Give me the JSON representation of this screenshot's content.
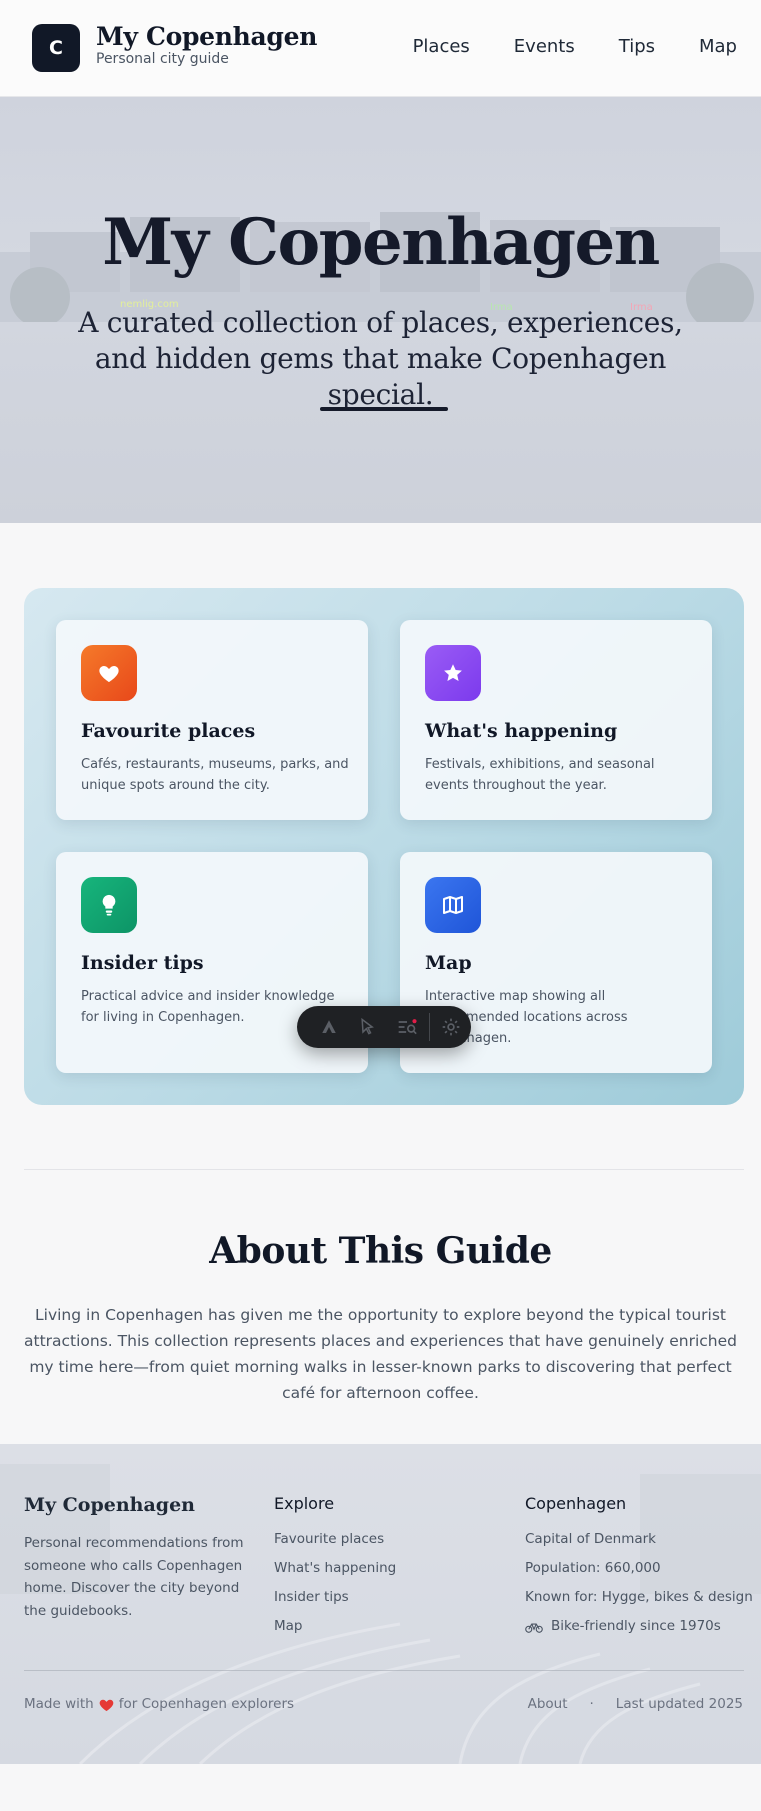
{
  "header": {
    "logo_letter": "C",
    "title": "My Copenhagen",
    "subtitle": "Personal city guide",
    "nav": [
      "Places",
      "Events",
      "Tips",
      "Map"
    ]
  },
  "hero": {
    "title": "My Copenhagen",
    "subtitle": "A curated collection of places, experiences, and hidden gems that make Copenhagen special."
  },
  "features": [
    {
      "title": "Favourite places",
      "description": "Cafés, restaurants, museums, parks, and unique spots around the city.",
      "icon": "heart-icon",
      "color": "#f05a1e"
    },
    {
      "title": "What's happening",
      "description": "Festivals, exhibitions, and seasonal events throughout the year.",
      "icon": "star-icon",
      "color": "#8b4cf0"
    },
    {
      "title": "Insider tips",
      "description": "Practical advice and insider knowledge for living in Copenhagen.",
      "icon": "lightbulb-icon",
      "color": "#10a36f"
    },
    {
      "title": "Map",
      "description": "Interactive map showing all recommended locations across Copenhagen.",
      "icon": "map-icon",
      "color": "#2a63e8"
    }
  ],
  "toolbar": {
    "buttons": [
      "logo-icon",
      "cursor-select-icon",
      "list-search-icon",
      "settings-icon"
    ]
  },
  "about": {
    "title": "About This Guide",
    "text": "Living in Copenhagen has given me the opportunity to explore beyond the typical tourist attractions. This collection represents places and experiences that have genuinely enriched my time here—from quiet morning walks in lesser-known parks to discovering that perfect café for afternoon coffee."
  },
  "footer": {
    "brand": "My Copenhagen",
    "description": "Personal recommendations from someone who calls Copenhagen home. Discover the city beyond the guidebooks.",
    "explore_heading": "Explore",
    "explore_links": [
      "Favourite places",
      "What's happening",
      "Insider tips",
      "Map"
    ],
    "city_heading": "Copenhagen",
    "city_facts": [
      "Capital of Denmark",
      "Population: 660,000",
      "Known for: Hygge, bikes & design",
      "Bike-friendly since 1970s"
    ],
    "made_with_prefix": "Made with",
    "made_with_suffix": "for Copenhagen explorers",
    "about_link": "About",
    "separator": "·",
    "last_updated": "Last updated 2025"
  }
}
